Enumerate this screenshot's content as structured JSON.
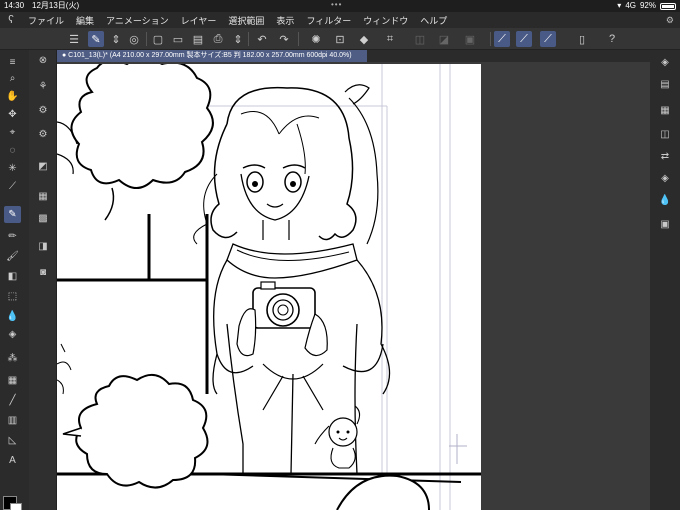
{
  "status": {
    "time": "14:30",
    "date": "12月13日(火)",
    "signal": "4G",
    "battery": "92%"
  },
  "menu": {
    "items": [
      "ファイル",
      "編集",
      "アニメーション",
      "レイヤー",
      "選択範囲",
      "表示",
      "フィルター",
      "ウィンドウ",
      "ヘルプ"
    ]
  },
  "document": {
    "tab_title": "● C101_13(L)* (A4 210.00 x 297.00mm 製本サイズ:B5 判 182.00 x 257.00mm 600dpi 40.0%)"
  },
  "colors": {
    "accent": "#4a5a86",
    "tab": "#4f5d85",
    "background": "#2b2b2b",
    "foreground_color": "#000000",
    "background_color": "#ffffff"
  }
}
